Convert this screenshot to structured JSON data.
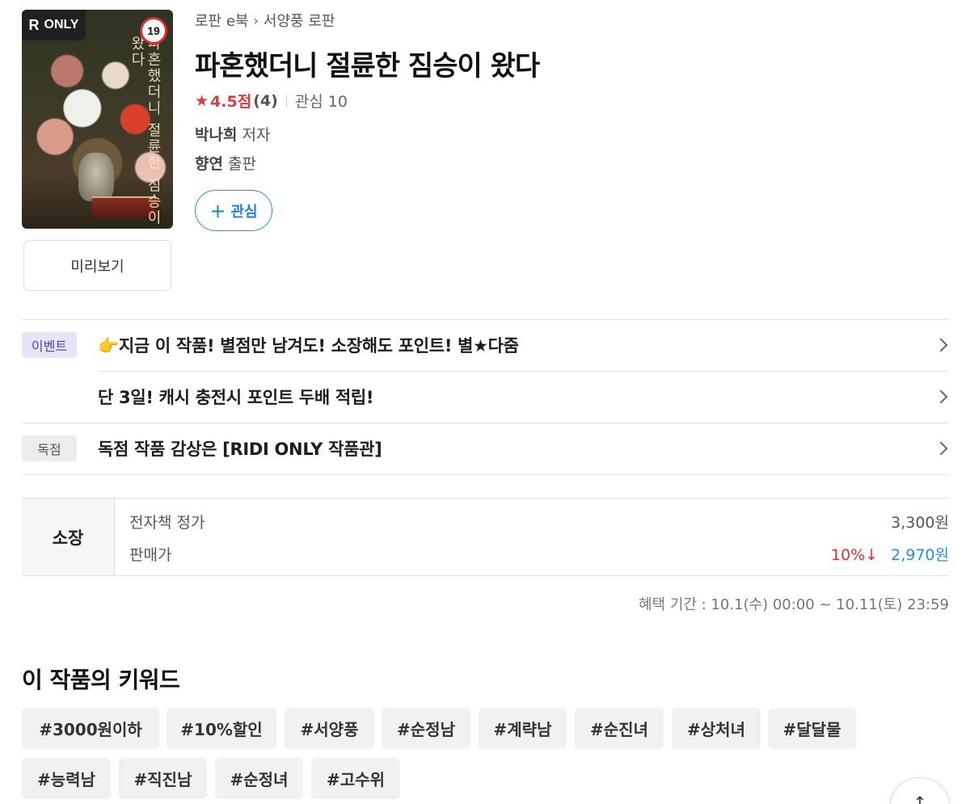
{
  "cover": {
    "badge_label": "ONLY",
    "badge_r": "R",
    "age_rating": "19",
    "cover_title": "파혼했더니 절륜한 짐승이 왔다"
  },
  "preview_label": "미리보기",
  "breadcrumb": [
    "로판 e북",
    "서양풍 로판"
  ],
  "title": "파혼했더니 절륜한 짐승이 왔다",
  "rating": {
    "star": "★",
    "score": "4.5점",
    "count": "(4)",
    "wish": "관심 10"
  },
  "author": {
    "name": "박나희",
    "role": "저자"
  },
  "publisher": {
    "name": "향연",
    "role": "출판"
  },
  "wish_button": {
    "icon": "+",
    "label": "관심"
  },
  "events": [
    {
      "tag": "이벤트",
      "text": "👉지금 이 작품! 별점만 남겨도! 소장해도 포인트! 별★다줌"
    },
    {
      "tag": "",
      "text": "단 3일! 캐시 충전시 포인트 두배 적립!"
    },
    {
      "tag": "독점",
      "text": "독점 작품 감상은 [RIDI ONLY 작품관]"
    }
  ],
  "price": {
    "label": "소장",
    "list_label": "전자책 정가",
    "list_value": "3,300원",
    "sale_label": "판매가",
    "discount": "10%↓",
    "sale_value": "2,970원"
  },
  "benefit_period": "혜택 기간 : 10.1(수) 00:00 ~ 10.11(토) 23:59",
  "keywords_title": "이 작품의 키워드",
  "keywords": [
    "#3000원이하",
    "#10%할인",
    "#서양풍",
    "#순정남",
    "#계략남",
    "#순진녀",
    "#상처녀",
    "#달달물",
    "#능력남",
    "#직진남",
    "#순정녀",
    "#고수위"
  ],
  "top_button_icon": "↑",
  "colors": {
    "accent_blue": "#2a8fd7",
    "accent_red": "#e03a3a",
    "event_tag_bg": "#e6e4f8"
  }
}
